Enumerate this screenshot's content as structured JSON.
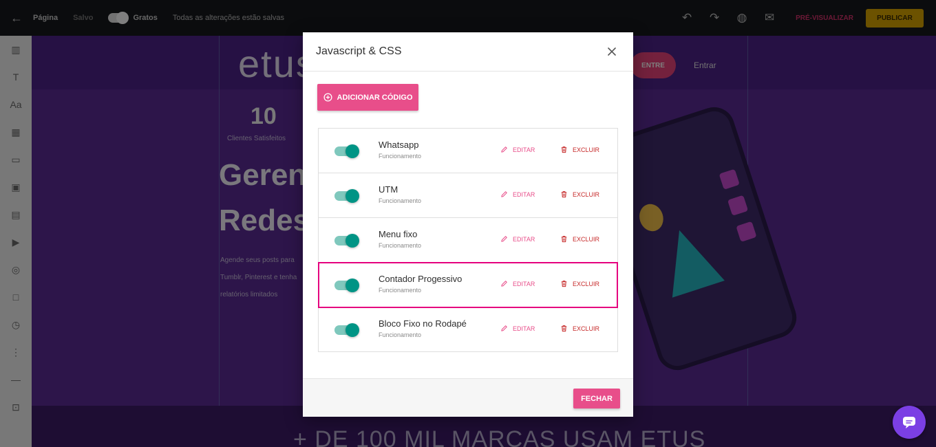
{
  "editor": {
    "topbar": {
      "item1": "Página",
      "item2": "Salvo",
      "item3": "Gratos",
      "status": "Todas as alterações estão salvas",
      "preview": "PRÉ-VISUALIZAR",
      "publish": "PUBLICAR"
    },
    "canvas": {
      "logo": "etus",
      "nav_button": "ENTRE",
      "nav_link": "Entrar",
      "stat_number": "10",
      "stat_label": "Clientes Satisfeitos",
      "headline_line1": "Geren",
      "headline_line2": "Redes",
      "paragraph": "Agende seus posts para Tumblr, Pinterest e tenha relatórios limitados",
      "bottom_text": "+ DE 100 MIL MARCAS USAM ETUS"
    }
  },
  "modal": {
    "title": "Javascript & CSS",
    "add_button": "ADICIONAR CÓDIGO",
    "edit_label": "EDITAR",
    "delete_label": "EXCLUIR",
    "close_button": "FECHAR",
    "items": [
      {
        "name": "Whatsapp",
        "status": "Funcionamento",
        "enabled": true
      },
      {
        "name": "UTM",
        "status": "Funcionamento",
        "enabled": true
      },
      {
        "name": "Menu fixo",
        "status": "Funcionamento",
        "enabled": true
      },
      {
        "name": "Contador Progessivo",
        "status": "Funcionamento",
        "enabled": true
      },
      {
        "name": "Bloco Fixo no Rodapé",
        "status": "Funcionamento",
        "enabled": true
      }
    ]
  },
  "colors": {
    "accent": "#e84e8a",
    "delete": "#c62828",
    "toggle_on": "#009485",
    "highlight": "#e5007e",
    "chat": "#7b3fe4"
  }
}
